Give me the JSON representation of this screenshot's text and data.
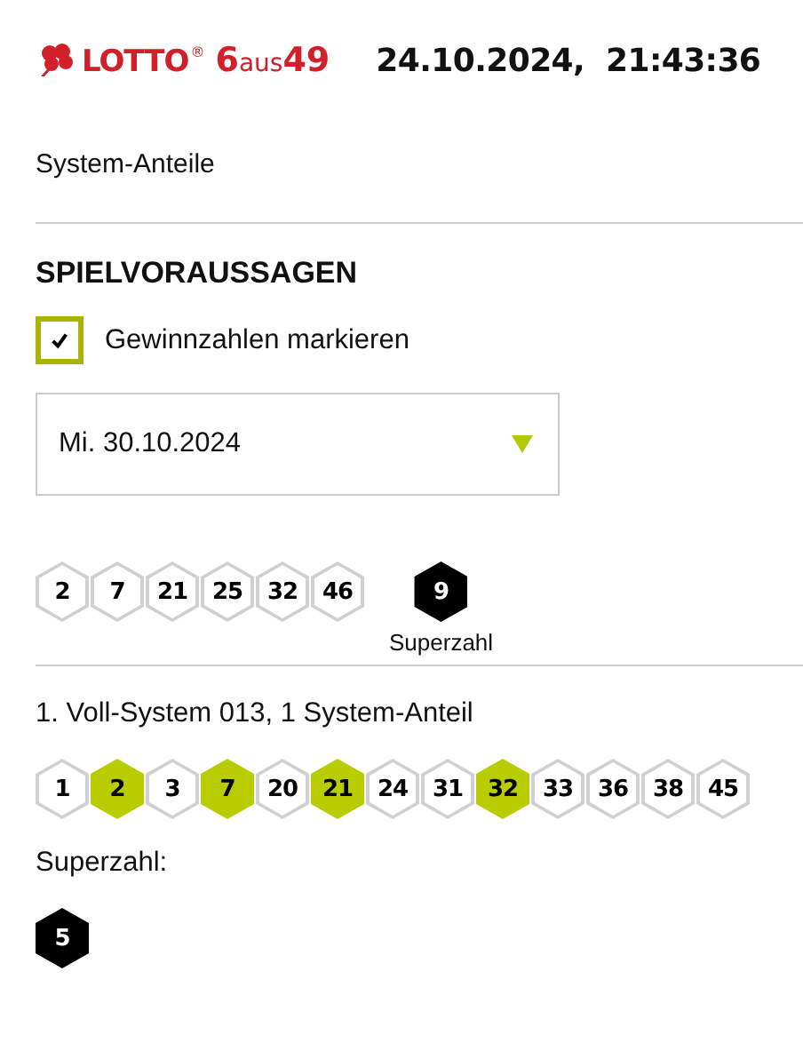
{
  "header": {
    "logo": {
      "word": "LOTTO",
      "registered": "®",
      "six": "6",
      "aus": "aus",
      "fortynine": "49"
    },
    "timestamp": "24.10.2024,  21:43:36"
  },
  "section_label": "System-Anteile",
  "predictions": {
    "title": "SPIELVORAUSSAGEN",
    "mark_winners": {
      "label": "Gewinnzahlen markieren",
      "checked": true
    },
    "draw_date": {
      "value": "Mi. 30.10.2024"
    },
    "winning_numbers": [
      "2",
      "7",
      "21",
      "25",
      "32",
      "46"
    ],
    "superzahl": {
      "value": "9",
      "label": "Superzahl"
    }
  },
  "systems": [
    {
      "title": "1. Voll-System 013, 1 System-Anteil",
      "numbers": [
        {
          "value": "1",
          "hit": false
        },
        {
          "value": "2",
          "hit": true
        },
        {
          "value": "3",
          "hit": false
        },
        {
          "value": "7",
          "hit": true
        },
        {
          "value": "20",
          "hit": false
        },
        {
          "value": "21",
          "hit": true
        },
        {
          "value": "24",
          "hit": false
        },
        {
          "value": "31",
          "hit": false
        },
        {
          "value": "32",
          "hit": true
        },
        {
          "value": "33",
          "hit": false
        },
        {
          "value": "36",
          "hit": false
        },
        {
          "value": "38",
          "hit": false
        },
        {
          "value": "45",
          "hit": false
        }
      ],
      "superzahl_label": "Superzahl:",
      "superzahl": "5"
    }
  ]
}
